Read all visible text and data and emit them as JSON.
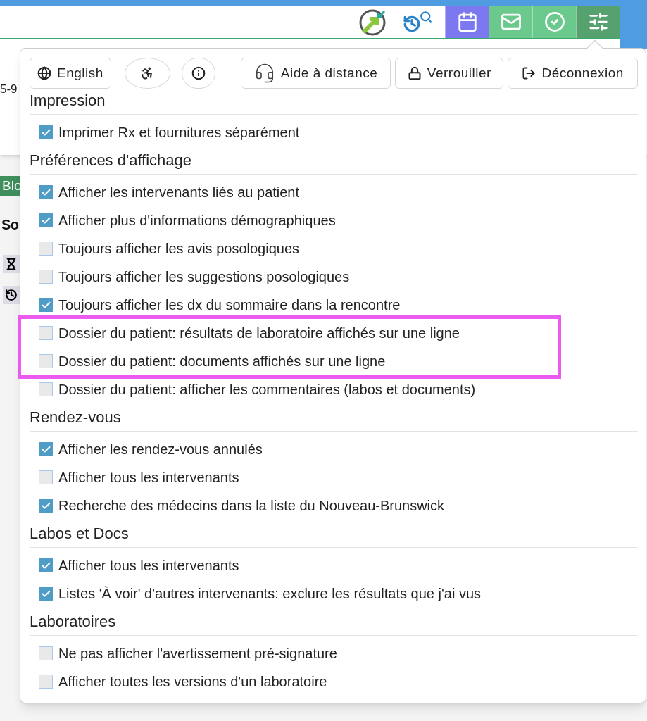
{
  "nav_tiles": [
    {
      "kind": "calendar",
      "color": "#7b78f0"
    },
    {
      "kind": "mail",
      "color": "#6cc98d"
    },
    {
      "kind": "check",
      "color": "#6cc98d"
    },
    {
      "kind": "settings",
      "color": "#55a26f"
    }
  ],
  "background": {
    "phone_fragment": "5-9",
    "badge": "Blo",
    "heading": "So"
  },
  "menu": {
    "buttons": [
      {
        "kind": "language",
        "label": "English"
      },
      {
        "kind": "accessibility"
      },
      {
        "kind": "info"
      },
      {
        "kind": "remote_help",
        "label": "Aide à distance"
      },
      {
        "kind": "lock",
        "label": "Verrouiller"
      },
      {
        "kind": "logout",
        "label": "Déconnexion"
      }
    ],
    "sections": [
      {
        "title": "Impression",
        "items": [
          {
            "label": "Imprimer Rx et fournitures séparément",
            "checked": true,
            "highlighted": false
          }
        ]
      },
      {
        "title": "Préférences d'affichage",
        "items": [
          {
            "label": "Afficher les intervenants liés au patient",
            "checked": true,
            "highlighted": false
          },
          {
            "label": "Afficher plus d'informations démographiques",
            "checked": true,
            "highlighted": false
          },
          {
            "label": "Toujours afficher les avis posologiques",
            "checked": false,
            "highlighted": false
          },
          {
            "label": "Toujours afficher les suggestions posologiques",
            "checked": false,
            "highlighted": false
          },
          {
            "label": "Toujours afficher les dx du sommaire dans la rencontre",
            "checked": true,
            "highlighted": false
          },
          {
            "label": "Dossier du patient: résultats de laboratoire affichés sur une ligne",
            "checked": false,
            "highlighted": true
          },
          {
            "label": "Dossier du patient: documents affichés sur une ligne",
            "checked": false,
            "highlighted": true
          },
          {
            "label": "Dossier du patient: afficher les commentaires (labos et documents)",
            "checked": false,
            "highlighted": false
          }
        ]
      },
      {
        "title": "Rendez-vous",
        "items": [
          {
            "label": "Afficher les rendez-vous annulés",
            "checked": true,
            "highlighted": false
          },
          {
            "label": "Afficher tous les intervenants",
            "checked": false,
            "highlighted": false
          },
          {
            "label": "Recherche des médecins dans la liste du Nouveau-Brunswick",
            "checked": true,
            "highlighted": false
          }
        ]
      },
      {
        "title": "Labos et Docs",
        "items": [
          {
            "label": "Afficher tous les intervenants",
            "checked": true,
            "highlighted": false
          },
          {
            "label": "Listes 'À voir' d'autres intervenants: exclure les résultats que j'ai vus",
            "checked": true,
            "highlighted": false
          }
        ]
      },
      {
        "title": "Laboratoires",
        "items": [
          {
            "label": "Ne pas afficher l'avertissement pré-signature",
            "checked": false,
            "highlighted": false
          },
          {
            "label": "Afficher toutes les versions d'un laboratoire",
            "checked": false,
            "highlighted": false
          }
        ]
      }
    ]
  }
}
